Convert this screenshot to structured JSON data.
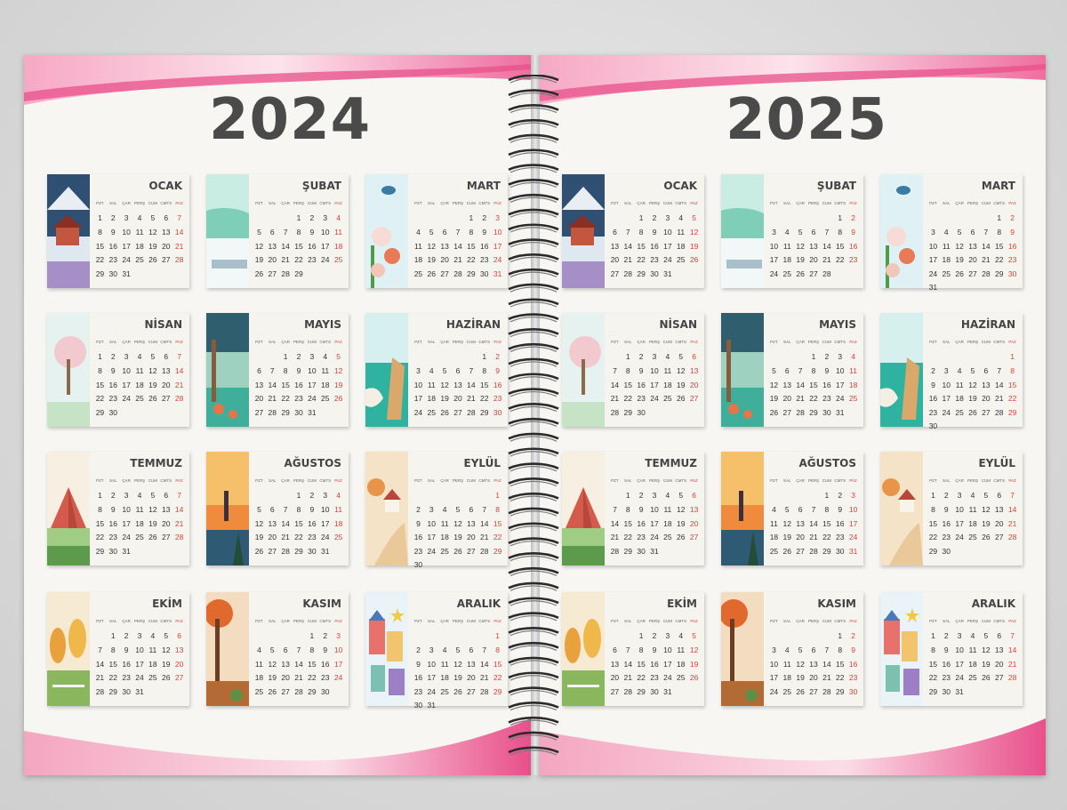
{
  "colors": {
    "accent_pink": "#e8508a",
    "sunday_red": "#d9423a",
    "year_gray": "#4a4a4a"
  },
  "weekday_headers": [
    "PZT",
    "SAL",
    "ÇAR",
    "PERŞ",
    "CUM",
    "CMTS",
    "PAZ"
  ],
  "pages": [
    {
      "year": "2024",
      "months": [
        {
          "name": "OCAK",
          "start": 0,
          "days": 31,
          "scene": "winter-house"
        },
        {
          "name": "ŞUBAT",
          "start": 3,
          "days": 29,
          "scene": "snowy-landscape"
        },
        {
          "name": "MART",
          "start": 4,
          "days": 31,
          "scene": "bird-flowers"
        },
        {
          "name": "NİSAN",
          "start": 0,
          "days": 30,
          "scene": "blossom-tree"
        },
        {
          "name": "MAYIS",
          "start": 2,
          "days": 31,
          "scene": "lake-tree"
        },
        {
          "name": "HAZİRAN",
          "start": 5,
          "days": 30,
          "scene": "sea-rocks"
        },
        {
          "name": "TEMMUZ",
          "start": 0,
          "days": 31,
          "scene": "camping-tent"
        },
        {
          "name": "AĞUSTOS",
          "start": 3,
          "days": 31,
          "scene": "sunset-lighthouse"
        },
        {
          "name": "EYLÜL",
          "start": 6,
          "days": 30,
          "scene": "autumn-house"
        },
        {
          "name": "EKİM",
          "start": 1,
          "days": 31,
          "scene": "autumn-trees"
        },
        {
          "name": "KASIM",
          "start": 4,
          "days": 30,
          "scene": "orange-forest"
        },
        {
          "name": "ARALIK",
          "start": 6,
          "days": 31,
          "scene": "christmas-town"
        }
      ]
    },
    {
      "year": "2025",
      "months": [
        {
          "name": "OCAK",
          "start": 2,
          "days": 31,
          "scene": "winter-house"
        },
        {
          "name": "ŞUBAT",
          "start": 5,
          "days": 28,
          "scene": "snowy-landscape"
        },
        {
          "name": "MART",
          "start": 5,
          "days": 31,
          "scene": "bird-flowers"
        },
        {
          "name": "NİSAN",
          "start": 1,
          "days": 30,
          "scene": "blossom-tree"
        },
        {
          "name": "MAYIS",
          "start": 3,
          "days": 31,
          "scene": "lake-tree"
        },
        {
          "name": "HAZİRAN",
          "start": 6,
          "days": 30,
          "scene": "sea-rocks"
        },
        {
          "name": "TEMMUZ",
          "start": 1,
          "days": 31,
          "scene": "camping-tent"
        },
        {
          "name": "AĞUSTOS",
          "start": 4,
          "days": 31,
          "scene": "sunset-lighthouse"
        },
        {
          "name": "EYLÜL",
          "start": 0,
          "days": 30,
          "scene": "autumn-house"
        },
        {
          "name": "EKİM",
          "start": 2,
          "days": 31,
          "scene": "autumn-trees"
        },
        {
          "name": "KASIM",
          "start": 5,
          "days": 30,
          "scene": "orange-forest"
        },
        {
          "name": "ARALIK",
          "start": 0,
          "days": 31,
          "scene": "christmas-town"
        }
      ]
    }
  ]
}
